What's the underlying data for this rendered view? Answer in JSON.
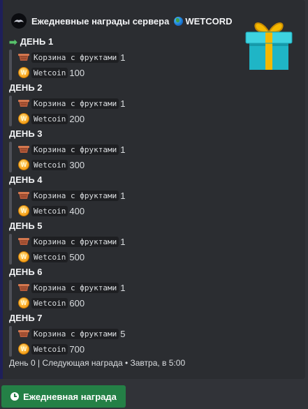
{
  "embed": {
    "author": "Ежедневные награды сервера",
    "server_name": "WETCORD",
    "accent_color": "#1e1f5a"
  },
  "days": [
    {
      "title": "ДЕНЬ 1",
      "current": true,
      "item_name": "Корзина с фруктами",
      "item_qty": "1",
      "coin_name": "Wetcoin",
      "coin_amount": "100"
    },
    {
      "title": "ДЕНЬ 2",
      "current": false,
      "item_name": "Корзина с фруктами",
      "item_qty": "1",
      "coin_name": "Wetcoin",
      "coin_amount": "200"
    },
    {
      "title": "ДЕНЬ 3",
      "current": false,
      "item_name": "Корзина с фруктами",
      "item_qty": "1",
      "coin_name": "Wetcoin",
      "coin_amount": "300"
    },
    {
      "title": "ДЕНЬ 4",
      "current": false,
      "item_name": "Корзина с фруктами",
      "item_qty": "1",
      "coin_name": "Wetcoin",
      "coin_amount": "400"
    },
    {
      "title": "ДЕНЬ 5",
      "current": false,
      "item_name": "Корзина с фруктами",
      "item_qty": "1",
      "coin_name": "Wetcoin",
      "coin_amount": "500"
    },
    {
      "title": "ДЕНЬ 6",
      "current": false,
      "item_name": "Корзина с фруктами",
      "item_qty": "1",
      "coin_name": "Wetcoin",
      "coin_amount": "600"
    },
    {
      "title": "ДЕНЬ 7",
      "current": false,
      "item_name": "Корзина с фруктами",
      "item_qty": "5",
      "coin_name": "Wetcoin",
      "coin_amount": "700"
    }
  ],
  "footer": "День 0 | Следующая награда • Завтра, в 5:00",
  "button": {
    "label": "Ежедневная награда",
    "color": "#248046"
  },
  "icons": {
    "item": "fruit-basket-icon",
    "coin": "wetcoin-icon",
    "thumbnail": "gift-box-icon",
    "current_day": "right-arrow-icon",
    "button": "clock-icon"
  }
}
